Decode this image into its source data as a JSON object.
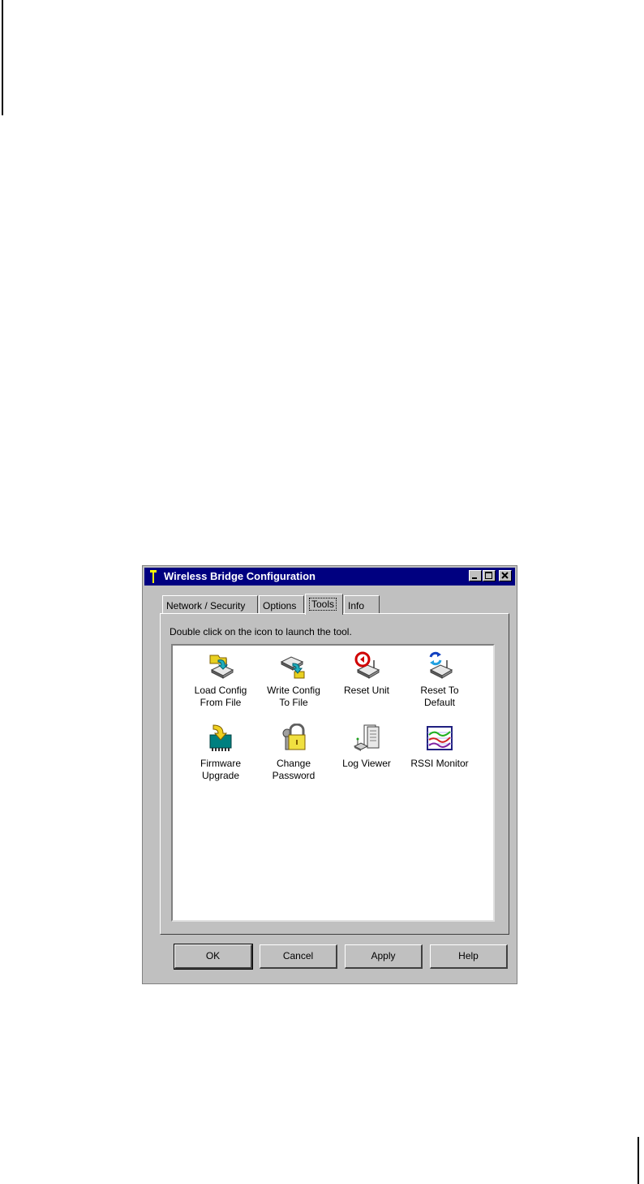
{
  "window": {
    "title": "Wireless Bridge Configuration",
    "title_bar_color": "#000080",
    "controls": [
      "minimize-icon",
      "maximize-icon",
      "close-icon"
    ]
  },
  "tabs": [
    {
      "label": "Network / Security",
      "selected": false
    },
    {
      "label": "Options",
      "selected": false
    },
    {
      "label": "Tools",
      "selected": true
    },
    {
      "label": "Info",
      "selected": false
    }
  ],
  "instruction": "Double click on the icon to launch the tool.",
  "tools": [
    {
      "line1": "Load Config",
      "line2": "From File",
      "icon": "load-config-icon"
    },
    {
      "line1": "Write Config",
      "line2": "To File",
      "icon": "write-config-icon"
    },
    {
      "line1": "Reset Unit",
      "line2": "",
      "icon": "reset-unit-icon"
    },
    {
      "line1": "Reset To",
      "line2": "Default",
      "icon": "reset-default-icon"
    },
    {
      "line1": "Firmware",
      "line2": "Upgrade",
      "icon": "firmware-upgrade-icon"
    },
    {
      "line1": "Change",
      "line2": "Password",
      "icon": "padlock-icon"
    },
    {
      "line1": "Log Viewer",
      "line2": "",
      "icon": "log-viewer-icon"
    },
    {
      "line1": "RSSI Monitor",
      "line2": "",
      "icon": "rssi-monitor-icon"
    }
  ],
  "buttons": {
    "ok": "OK",
    "cancel": "Cancel",
    "apply": "Apply",
    "help": "Help"
  }
}
